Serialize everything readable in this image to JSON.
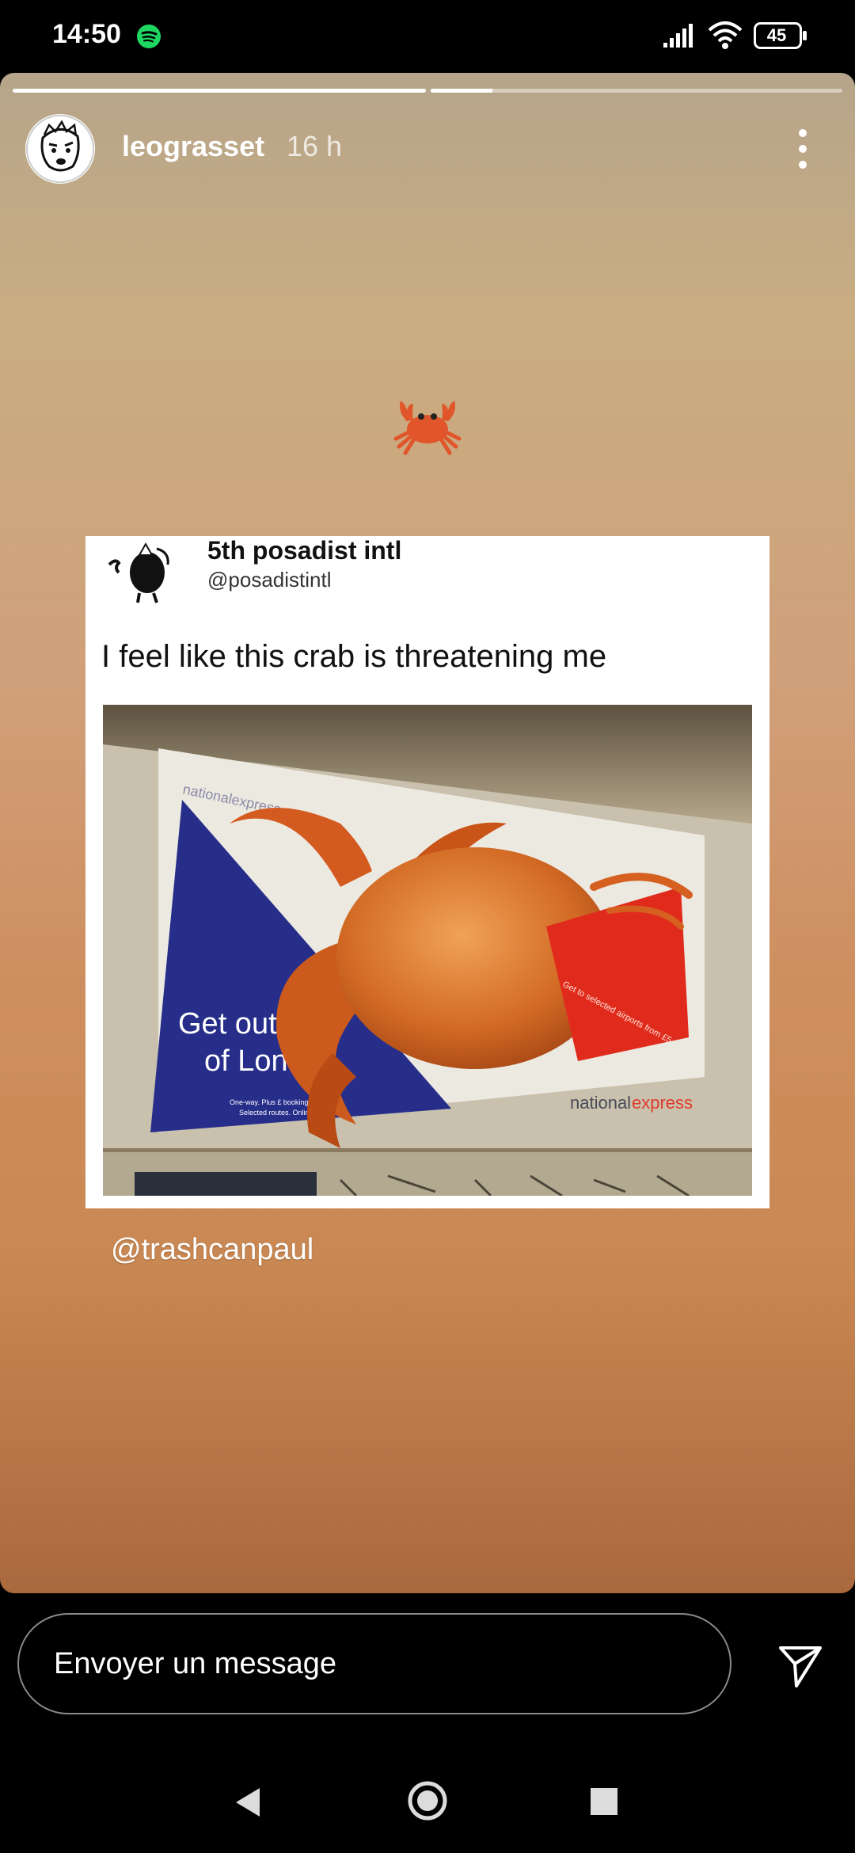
{
  "status_bar": {
    "time": "14:50",
    "battery": "45",
    "icons": [
      "spotify-icon",
      "signal-icon",
      "wifi-icon",
      "battery-icon"
    ]
  },
  "story": {
    "progress": [
      1.0,
      0.15
    ],
    "username": "leograsset",
    "time_ago": "16 h",
    "emoji": "crab",
    "mention": "@trashcanpaul"
  },
  "meme": {
    "author_name": "5th posadist intl",
    "author_handle": "@posadistintl",
    "tweet_text": "I feel like this crab is threatening me",
    "ad_site": "nationalexpress.com",
    "ad_headline_1": "Get out",
    "ad_headline_2": "of London",
    "ad_brand_1": "national",
    "ad_brand_2": "express",
    "ad_side_text": "Get to selected airports from £5",
    "ad_fine_1": "One-way. Plus £ booking fee",
    "ad_fine_2": "Selected routes. Online only"
  },
  "message_bar": {
    "placeholder": "Envoyer un message"
  },
  "colors": {
    "story_top": "#b6a58a",
    "story_bottom": "#a9693e",
    "crab": "#e0562a",
    "ad_navy": "#262e8a"
  }
}
